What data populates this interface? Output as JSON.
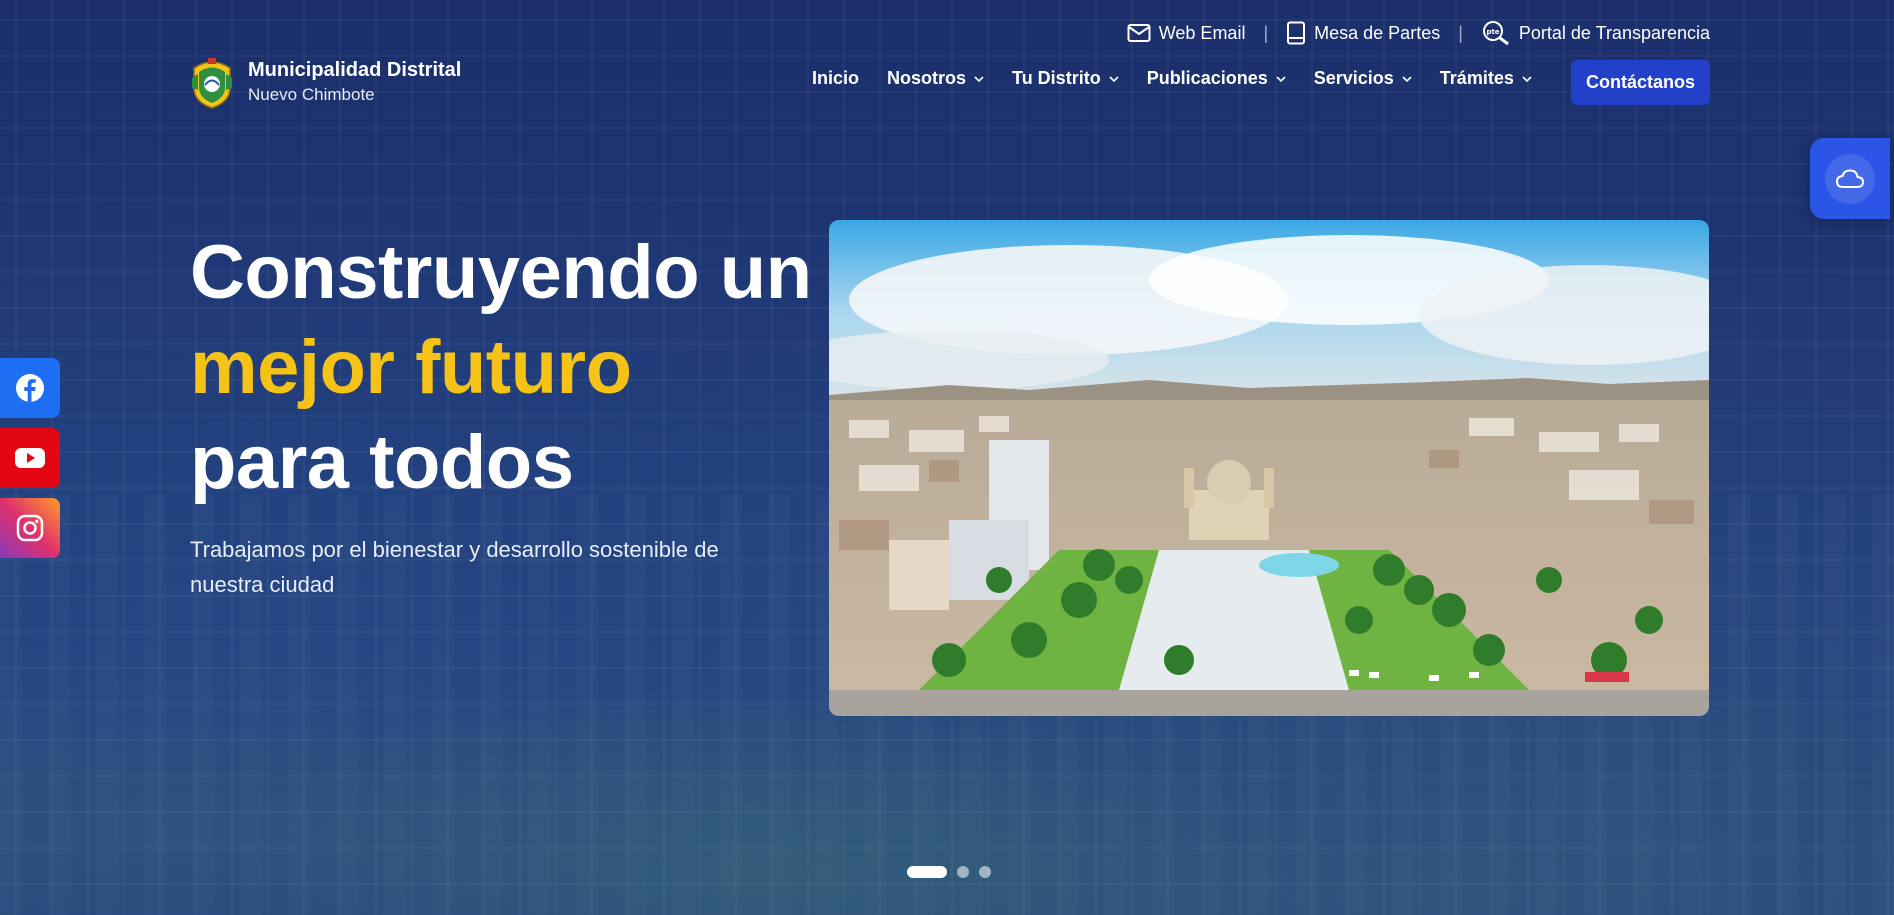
{
  "topbar": {
    "web_email": "Web Email",
    "mesa_partes": "Mesa de Partes",
    "portal": "Portal de Transparencia",
    "separator": "|"
  },
  "brand": {
    "line1": "Municipalidad Distrital",
    "line2": "Nuevo Chimbote"
  },
  "nav": {
    "items": [
      {
        "label": "Inicio",
        "dropdown": false
      },
      {
        "label": "Nosotros",
        "dropdown": true
      },
      {
        "label": "Tu Distrito",
        "dropdown": true
      },
      {
        "label": "Publicaciones",
        "dropdown": true
      },
      {
        "label": "Servicios",
        "dropdown": true
      },
      {
        "label": "Trámites",
        "dropdown": true
      }
    ],
    "cta": "Contáctanos"
  },
  "hero": {
    "title_line1": "Construyendo un",
    "title_accent": "mejor futuro",
    "title_line3": "para todos",
    "subtitle": "Trabajamos por el bienestar y desarrollo sostenible de nuestra ciudad"
  },
  "social": [
    "facebook-icon",
    "youtube-icon",
    "instagram-icon"
  ],
  "colors": {
    "background": "#1b2f6b",
    "accent": "#f5c217",
    "cta": "#2340c8",
    "weather": "#2a55e6"
  },
  "carousel": {
    "slides": 3,
    "active": 1
  }
}
